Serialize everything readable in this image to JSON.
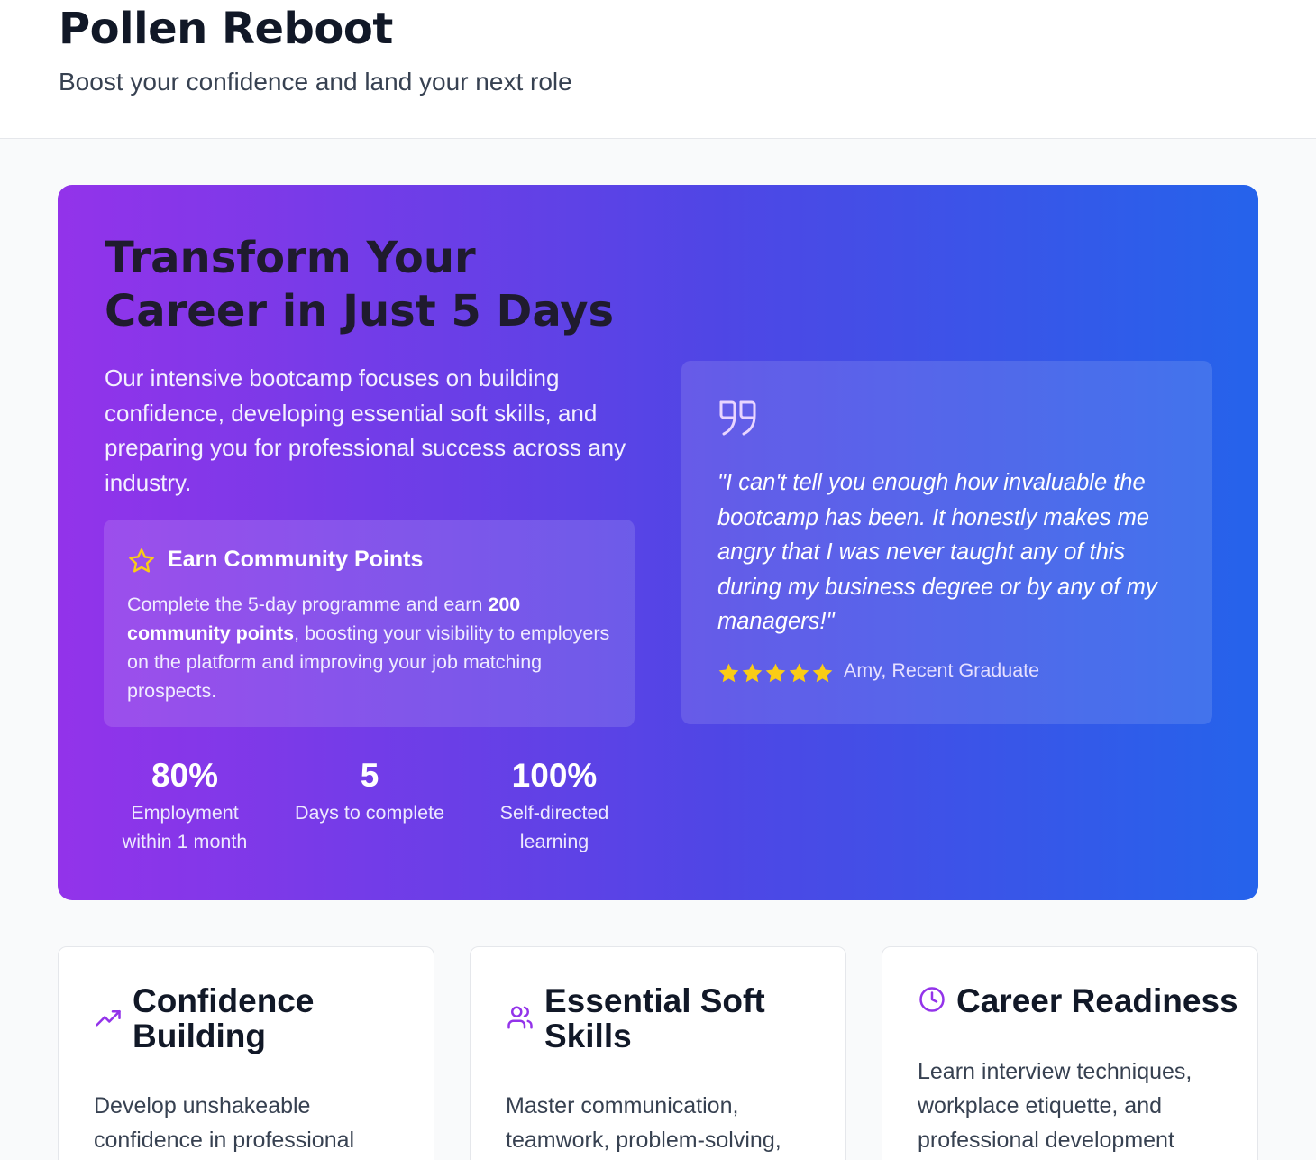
{
  "header": {
    "title": "Pollen Reboot",
    "subtitle": "Boost your confidence and land your next role"
  },
  "hero": {
    "title": "Transform Your Career in Just 5 Days",
    "description": "Our intensive bootcamp focuses on building confidence, developing essential soft skills, and preparing you for professional success across any industry.",
    "points": {
      "icon": "star-outline-icon",
      "title": "Earn Community Points",
      "text_before": "Complete the 5-day programme and earn ",
      "text_bold": "200 community points",
      "text_after": ", boosting your visibility to employers on the platform and improving your job matching prospects."
    },
    "stats": [
      {
        "value": "80%",
        "label": "Employment within 1 month"
      },
      {
        "value": "5",
        "label": "Days to complete"
      },
      {
        "value": "100%",
        "label": "Self-directed learning"
      }
    ],
    "testimonial": {
      "icon": "quote-icon",
      "quote": "\"I can't tell you enough how invaluable the bootcamp has been. It honestly makes me angry that I was never taught any of this during my business degree or by any of my managers!\"",
      "rating": 5,
      "author": "Amy, Recent Graduate"
    }
  },
  "cards": [
    {
      "icon": "trending-up-icon",
      "title": "Confidence Building",
      "text": "Develop unshakeable confidence in professional"
    },
    {
      "icon": "users-icon",
      "title": "Essential Soft Skills",
      "text": "Master communication, teamwork, problem-solving,"
    },
    {
      "icon": "clock-icon",
      "title": "Career Readiness",
      "text": "Learn interview techniques, workplace etiquette, and professional development"
    }
  ],
  "colors": {
    "gradient_start": "#9333ea",
    "gradient_end": "#2563eb",
    "star": "#facc15",
    "accent_purple": "#9333ea"
  }
}
